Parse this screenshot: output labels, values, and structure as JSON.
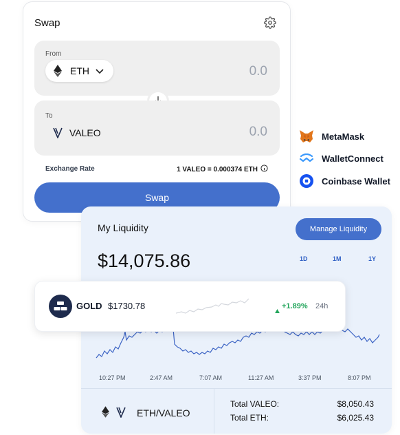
{
  "swap": {
    "title": "Swap",
    "from_label": "From",
    "from_token": "ETH",
    "from_amount": "0.0",
    "to_label": "To",
    "to_token": "VALEO",
    "to_amount": "0.0",
    "rate_label": "Exchange Rate",
    "rate_value": "1 VALEO = 0.000374 ETH",
    "button_label": "Swap"
  },
  "wallets": [
    {
      "name": "MetaMask",
      "icon": "metamask-icon"
    },
    {
      "name": "WalletConnect",
      "icon": "walletconnect-icon"
    },
    {
      "name": "Coinbase Wallet",
      "icon": "coinbase-icon"
    }
  ],
  "liquidity": {
    "title": "My Liquidity",
    "manage_label": "Manage Liquidity",
    "value": "$14,075.86",
    "ranges": [
      "1D",
      "1M",
      "1Y"
    ],
    "time_labels": [
      "10:27 PM",
      "2:47 AM",
      "7:07 AM",
      "11:27 AM",
      "3:37 PM",
      "8:07 PM"
    ],
    "pair": "ETH/VALEO",
    "totals": [
      {
        "label": "Total VALEO:",
        "value": "$8,050.43"
      },
      {
        "label": "Total ETH:",
        "value": "$6,025.43"
      }
    ]
  },
  "gold": {
    "name": "GOLD",
    "price": "$1730.78",
    "change": "+1.89%",
    "period": "24h"
  },
  "colors": {
    "accent": "#4470cc",
    "positive": "#22a55b",
    "chart_line": "#3b63c4",
    "liquidity_bg": "#eaf1fb"
  }
}
